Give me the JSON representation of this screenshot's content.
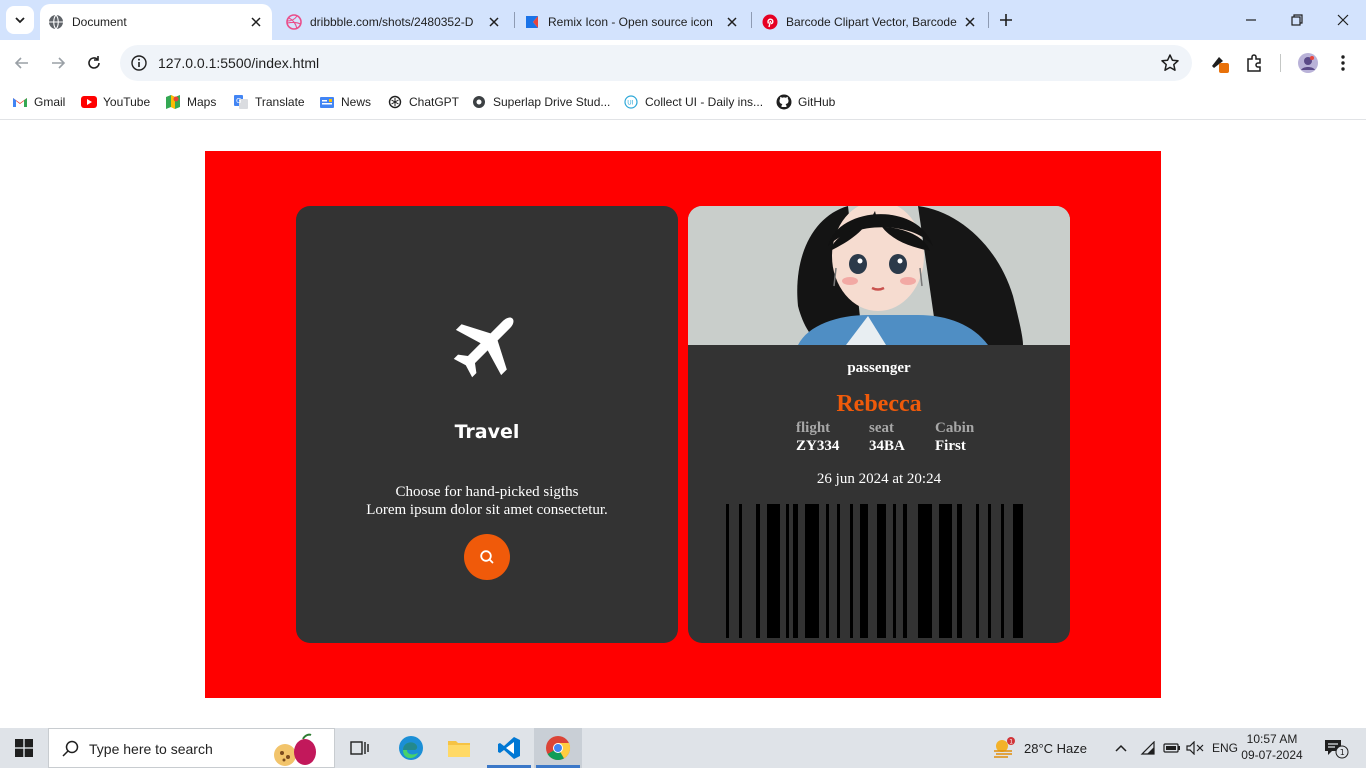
{
  "browser": {
    "tabs": [
      {
        "title": "Document",
        "active": true,
        "favicon": "globe-icon"
      },
      {
        "title": "dribbble.com/shots/2480352-D",
        "active": false,
        "favicon": "dribbble-icon"
      },
      {
        "title": "Remix Icon - Open source icon",
        "active": false,
        "favicon": "remix-icon"
      },
      {
        "title": "Barcode Clipart Vector, Barcode",
        "active": false,
        "favicon": "pinterest-icon"
      }
    ],
    "url": "127.0.0.1:5500/index.html",
    "bookmarks": [
      {
        "label": "Gmail",
        "icon": "gmail-icon"
      },
      {
        "label": "YouTube",
        "icon": "youtube-icon"
      },
      {
        "label": "Maps",
        "icon": "maps-icon"
      },
      {
        "label": "Translate",
        "icon": "translate-icon"
      },
      {
        "label": "News",
        "icon": "news-icon"
      },
      {
        "label": "ChatGPT",
        "icon": "chatgpt-icon"
      },
      {
        "label": "Superlap Drive Stud...",
        "icon": "superlap-icon"
      },
      {
        "label": "Collect UI - Daily ins...",
        "icon": "collectui-icon"
      },
      {
        "label": "GitHub",
        "icon": "github-icon"
      }
    ]
  },
  "travel_card": {
    "title": "Travel",
    "desc_line1": "Choose for hand-picked sigths",
    "desc_line2": "Lorem ipsum dolor sit amet consectetur."
  },
  "ticket": {
    "label": "passenger",
    "name": "Rebecca",
    "fields": [
      {
        "label": "flight",
        "value": "ZY334"
      },
      {
        "label": "seat",
        "value": "34BA"
      },
      {
        "label": "Cabin",
        "value": "First"
      }
    ],
    "date": "26 jun 2024 at 20:24"
  },
  "taskbar": {
    "search_placeholder": "Type here to search",
    "weather": "28°C  Haze",
    "weather_badge": "1",
    "language": "ENG",
    "time": "10:57 AM",
    "date": "09-07-2024",
    "notifications": "1"
  },
  "colors": {
    "background_red": "#ff0000",
    "card": "#333333",
    "accent_orange": "#f05a0a"
  }
}
